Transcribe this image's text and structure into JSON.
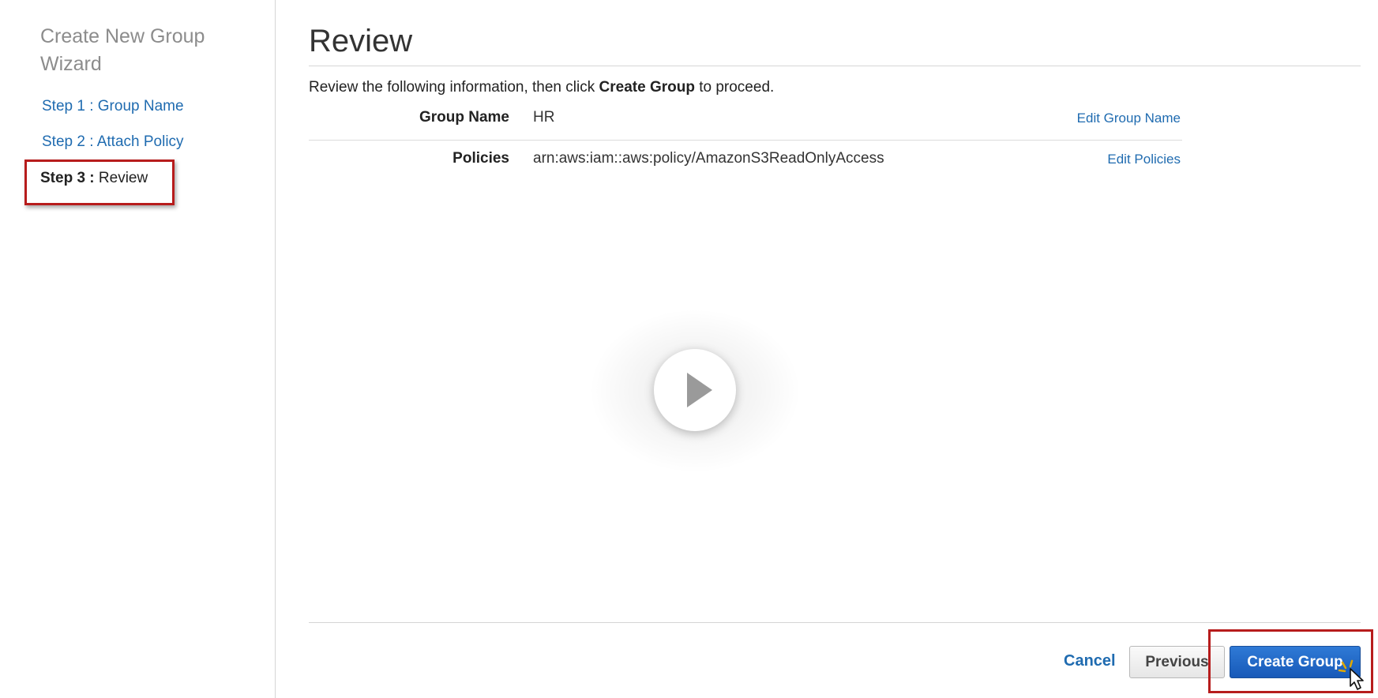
{
  "sidebar": {
    "title": "Create New Group Wizard",
    "steps": [
      {
        "label": "Step 1 : Group Name"
      },
      {
        "label": "Step 2 : Attach Policy"
      }
    ],
    "current": {
      "prefix": "Step 3 :",
      "label": "Review"
    }
  },
  "main": {
    "title": "Review",
    "instructions": {
      "before": "Review the following information, then click",
      "emphasis": "Create Group",
      "after": "to proceed."
    },
    "rows": [
      {
        "label": "Group Name",
        "value": "HR",
        "edit": "Edit Group Name"
      },
      {
        "label": "Policies",
        "value": "arn:aws:iam::aws:policy/AmazonS3ReadOnlyAccess",
        "edit": "Edit Policies"
      }
    ]
  },
  "footer": {
    "cancel": "Cancel",
    "previous": "Previous",
    "create": "Create Group"
  },
  "icons": {
    "play": "play-icon",
    "cursor": "pointer-cursor-icon"
  },
  "colors": {
    "link": "#1f6bb0",
    "primary": "#1f66c5",
    "highlight": "#b71c1c"
  }
}
